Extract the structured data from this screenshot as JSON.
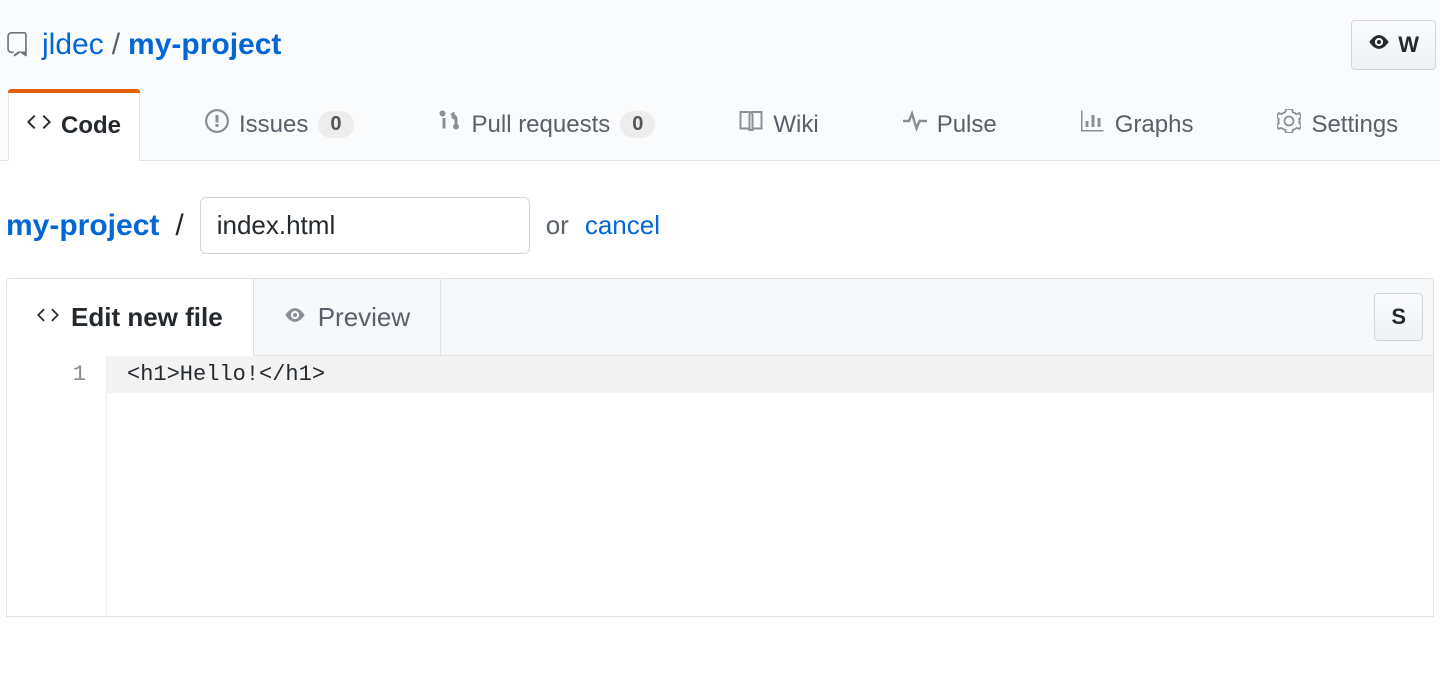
{
  "header": {
    "owner": "jldec",
    "repo": "my-project",
    "separator": "/",
    "watch_label": "W"
  },
  "nav": {
    "tabs": [
      {
        "label": "Code",
        "count": null,
        "active": true
      },
      {
        "label": "Issues",
        "count": "0",
        "active": false
      },
      {
        "label": "Pull requests",
        "count": "0",
        "active": false
      },
      {
        "label": "Wiki",
        "count": null,
        "active": false
      },
      {
        "label": "Pulse",
        "count": null,
        "active": false
      },
      {
        "label": "Graphs",
        "count": null,
        "active": false
      },
      {
        "label": "Settings",
        "count": null,
        "active": false
      }
    ]
  },
  "filepath": {
    "repo_link": "my-project",
    "slash": "/",
    "filename_value": "index.html",
    "or_text": "or",
    "cancel": "cancel"
  },
  "editor": {
    "tab_edit": "Edit new file",
    "tab_preview": "Preview",
    "right_button": "S",
    "lines": [
      {
        "num": "1",
        "text": "<h1>Hello!</h1>"
      }
    ]
  }
}
